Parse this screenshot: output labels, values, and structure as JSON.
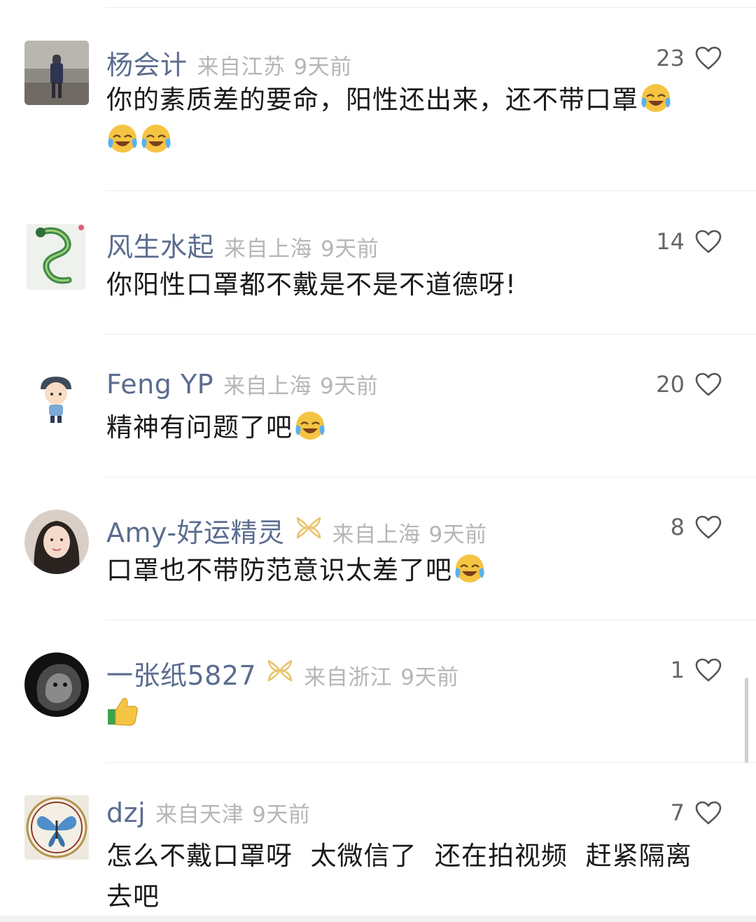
{
  "comments": [
    {
      "username": "杨会计",
      "location": "来自江苏",
      "time": "9天前",
      "likes": "23",
      "text": "你的素质差的要命，阳性还出来，还不带口罩",
      "emoji_count": 3,
      "has_badge": false
    },
    {
      "username": "风生水起",
      "location": "来自上海",
      "time": "9天前",
      "likes": "14",
      "text": "你阳性口罩都不戴是不是不道德呀!",
      "emoji_count": 0,
      "has_badge": false
    },
    {
      "username": "Feng YP",
      "location": "来自上海",
      "time": "9天前",
      "likes": "20",
      "text": "精神有问题了吧",
      "emoji_count": 1,
      "has_badge": false
    },
    {
      "username": "Amy-好运精灵",
      "location": "来自上海",
      "time": "9天前",
      "likes": "8",
      "text": "口罩也不带防范意识太差了吧",
      "emoji_count": 1,
      "has_badge": true
    },
    {
      "username": "一张纸5827",
      "location": "来自浙江",
      "time": "9天前",
      "likes": "1",
      "text": "",
      "emoji_count": 1,
      "emoji_kind": "thumbs-up",
      "has_badge": true
    },
    {
      "username": "dzj",
      "location": "来自天津",
      "time": "9天前",
      "likes": "7",
      "text": "怎么不戴口罩呀  太微信了  还在拍视频  赶紧隔离去吧",
      "emoji_count": 0,
      "has_badge": false
    }
  ],
  "colors": {
    "username": "#5b6c8f",
    "meta": "#b6b6b6",
    "text": "#1a1a1a",
    "badge": "#e8c56d"
  },
  "icons": {
    "like": "heart-outline-icon",
    "emoji": "laughing-crying-emoji",
    "badge": "vip-bow-icon",
    "thumbs": "thumbs-up-emoji"
  }
}
